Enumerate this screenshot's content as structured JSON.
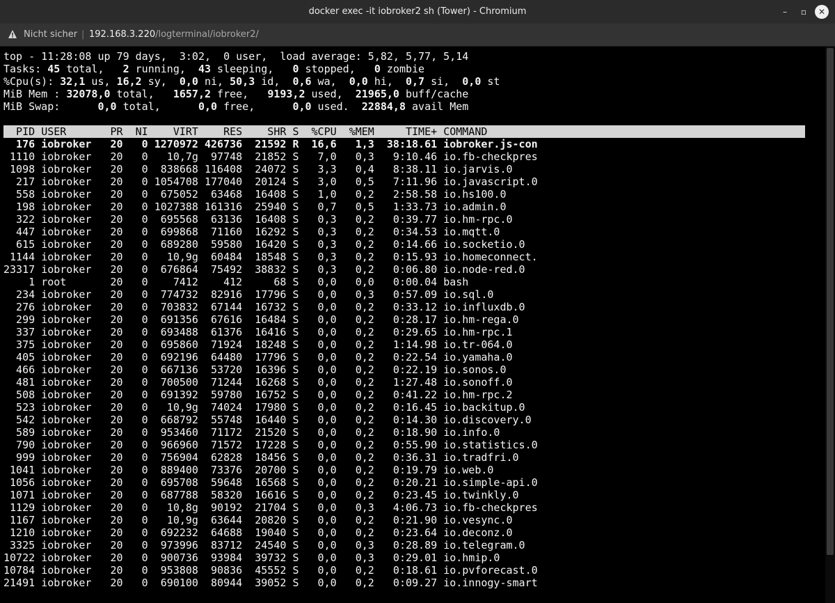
{
  "window": {
    "title": "docker exec -it iobroker2 sh (Tower) - Chromium",
    "buttons": [
      "–",
      "▫",
      "✕"
    ]
  },
  "address": {
    "security_label": "Nicht sicher",
    "separator": "|",
    "host": "192.168.3.220",
    "path": "/logterminal/iobroker2/"
  },
  "top": {
    "summary": [
      [
        [
          "top - 11:28:08 up 79 days,  3:02,  0 user,  load average: 5,82, 5,77, 5,14",
          false
        ]
      ],
      [
        [
          "Tasks: ",
          false
        ],
        [
          "45",
          true
        ],
        [
          " total,   ",
          false
        ],
        [
          "2",
          true
        ],
        [
          " running,  ",
          false
        ],
        [
          "43",
          true
        ],
        [
          " sleeping,   ",
          false
        ],
        [
          "0",
          true
        ],
        [
          " stopped,   ",
          false
        ],
        [
          "0",
          true
        ],
        [
          " zombie",
          false
        ]
      ],
      [
        [
          "%Cpu(s): ",
          false
        ],
        [
          "32,1",
          true
        ],
        [
          " us, ",
          false
        ],
        [
          "16,2",
          true
        ],
        [
          " sy,  ",
          false
        ],
        [
          "0,0",
          true
        ],
        [
          " ni, ",
          false
        ],
        [
          "50,3",
          true
        ],
        [
          " id,  ",
          false
        ],
        [
          "0,6",
          true
        ],
        [
          " wa,  ",
          false
        ],
        [
          "0,0",
          true
        ],
        [
          " hi,  ",
          false
        ],
        [
          "0,7",
          true
        ],
        [
          " si,  ",
          false
        ],
        [
          "0,0",
          true
        ],
        [
          " st",
          false
        ]
      ],
      [
        [
          "MiB Mem : ",
          false
        ],
        [
          "32078,0",
          true
        ],
        [
          " total,   ",
          false
        ],
        [
          "1657,2",
          true
        ],
        [
          " free,   ",
          false
        ],
        [
          "9193,2",
          true
        ],
        [
          " used,  ",
          false
        ],
        [
          "21965,0",
          true
        ],
        [
          " buff/cache",
          false
        ]
      ],
      [
        [
          "MiB Swap:      ",
          false
        ],
        [
          "0,0",
          true
        ],
        [
          " total,      ",
          false
        ],
        [
          "0,0",
          true
        ],
        [
          " free,      ",
          false
        ],
        [
          "0,0",
          true
        ],
        [
          " used.  ",
          false
        ],
        [
          "22884,8",
          true
        ],
        [
          " avail Mem",
          false
        ]
      ]
    ],
    "columns": [
      "PID",
      "USER",
      "PR",
      "NI",
      "VIRT",
      "RES",
      "SHR",
      "S",
      "%CPU",
      "%MEM",
      "TIME+",
      "COMMAND"
    ],
    "processes": [
      [
        "176",
        "iobroker",
        "20",
        "0",
        "1270972",
        "426736",
        "21592",
        "R",
        "16,6",
        "1,3",
        "38:18.61",
        "iobroker.js-con"
      ],
      [
        "1110",
        "iobroker",
        "20",
        "0",
        "10,7g",
        "97748",
        "21852",
        "S",
        "7,0",
        "0,3",
        "9:10.46",
        "io.fb-checkpres"
      ],
      [
        "1098",
        "iobroker",
        "20",
        "0",
        "838668",
        "116408",
        "24072",
        "S",
        "3,3",
        "0,4",
        "8:38.11",
        "io.jarvis.0"
      ],
      [
        "217",
        "iobroker",
        "20",
        "0",
        "1054708",
        "177040",
        "20124",
        "S",
        "3,0",
        "0,5",
        "7:11.96",
        "io.javascript.0"
      ],
      [
        "558",
        "iobroker",
        "20",
        "0",
        "675052",
        "63468",
        "16408",
        "S",
        "1,0",
        "0,2",
        "2:58.58",
        "io.hs100.0"
      ],
      [
        "198",
        "iobroker",
        "20",
        "0",
        "1027388",
        "161316",
        "25940",
        "S",
        "0,7",
        "0,5",
        "1:33.73",
        "io.admin.0"
      ],
      [
        "322",
        "iobroker",
        "20",
        "0",
        "695568",
        "63136",
        "16408",
        "S",
        "0,3",
        "0,2",
        "0:39.77",
        "io.hm-rpc.0"
      ],
      [
        "447",
        "iobroker",
        "20",
        "0",
        "699868",
        "71160",
        "16292",
        "S",
        "0,3",
        "0,2",
        "0:34.53",
        "io.mqtt.0"
      ],
      [
        "615",
        "iobroker",
        "20",
        "0",
        "689280",
        "59580",
        "16420",
        "S",
        "0,3",
        "0,2",
        "0:14.66",
        "io.socketio.0"
      ],
      [
        "1144",
        "iobroker",
        "20",
        "0",
        "10,9g",
        "60484",
        "18548",
        "S",
        "0,3",
        "0,2",
        "0:15.93",
        "io.homeconnect."
      ],
      [
        "23317",
        "iobroker",
        "20",
        "0",
        "676864",
        "75492",
        "38832",
        "S",
        "0,3",
        "0,2",
        "0:06.80",
        "io.node-red.0"
      ],
      [
        "1",
        "root",
        "20",
        "0",
        "7412",
        "412",
        "68",
        "S",
        "0,0",
        "0,0",
        "0:00.04",
        "bash"
      ],
      [
        "234",
        "iobroker",
        "20",
        "0",
        "774732",
        "82916",
        "17796",
        "S",
        "0,0",
        "0,3",
        "0:57.09",
        "io.sql.0"
      ],
      [
        "276",
        "iobroker",
        "20",
        "0",
        "703832",
        "67144",
        "16732",
        "S",
        "0,0",
        "0,2",
        "0:33.12",
        "io.influxdb.0"
      ],
      [
        "299",
        "iobroker",
        "20",
        "0",
        "691356",
        "67616",
        "16484",
        "S",
        "0,0",
        "0,2",
        "0:28.17",
        "io.hm-rega.0"
      ],
      [
        "337",
        "iobroker",
        "20",
        "0",
        "693488",
        "61376",
        "16416",
        "S",
        "0,0",
        "0,2",
        "0:29.65",
        "io.hm-rpc.1"
      ],
      [
        "375",
        "iobroker",
        "20",
        "0",
        "695860",
        "71924",
        "18248",
        "S",
        "0,0",
        "0,2",
        "1:14.98",
        "io.tr-064.0"
      ],
      [
        "405",
        "iobroker",
        "20",
        "0",
        "692196",
        "64480",
        "17796",
        "S",
        "0,0",
        "0,2",
        "0:22.54",
        "io.yamaha.0"
      ],
      [
        "466",
        "iobroker",
        "20",
        "0",
        "667136",
        "53720",
        "16396",
        "S",
        "0,0",
        "0,2",
        "0:22.19",
        "io.sonos.0"
      ],
      [
        "481",
        "iobroker",
        "20",
        "0",
        "700500",
        "71244",
        "16268",
        "S",
        "0,0",
        "0,2",
        "1:27.48",
        "io.sonoff.0"
      ],
      [
        "508",
        "iobroker",
        "20",
        "0",
        "691392",
        "59780",
        "16752",
        "S",
        "0,0",
        "0,2",
        "0:41.22",
        "io.hm-rpc.2"
      ],
      [
        "523",
        "iobroker",
        "20",
        "0",
        "10,9g",
        "74024",
        "17980",
        "S",
        "0,0",
        "0,2",
        "0:16.45",
        "io.backitup.0"
      ],
      [
        "542",
        "iobroker",
        "20",
        "0",
        "668792",
        "55748",
        "16440",
        "S",
        "0,0",
        "0,2",
        "0:14.30",
        "io.discovery.0"
      ],
      [
        "589",
        "iobroker",
        "20",
        "0",
        "953460",
        "71172",
        "21520",
        "S",
        "0,0",
        "0,2",
        "0:18.90",
        "io.info.0"
      ],
      [
        "790",
        "iobroker",
        "20",
        "0",
        "966960",
        "71572",
        "17228",
        "S",
        "0,0",
        "0,2",
        "0:55.90",
        "io.statistics.0"
      ],
      [
        "999",
        "iobroker",
        "20",
        "0",
        "756904",
        "62828",
        "18456",
        "S",
        "0,0",
        "0,2",
        "0:36.31",
        "io.tradfri.0"
      ],
      [
        "1041",
        "iobroker",
        "20",
        "0",
        "889400",
        "73376",
        "20700",
        "S",
        "0,0",
        "0,2",
        "0:19.79",
        "io.web.0"
      ],
      [
        "1056",
        "iobroker",
        "20",
        "0",
        "695708",
        "59648",
        "16568",
        "S",
        "0,0",
        "0,2",
        "0:20.21",
        "io.simple-api.0"
      ],
      [
        "1071",
        "iobroker",
        "20",
        "0",
        "687788",
        "58320",
        "16616",
        "S",
        "0,0",
        "0,2",
        "0:23.45",
        "io.twinkly.0"
      ],
      [
        "1129",
        "iobroker",
        "20",
        "0",
        "10,8g",
        "90192",
        "21704",
        "S",
        "0,0",
        "0,3",
        "4:06.73",
        "io.fb-checkpres"
      ],
      [
        "1167",
        "iobroker",
        "20",
        "0",
        "10,9g",
        "63644",
        "20820",
        "S",
        "0,0",
        "0,2",
        "0:21.90",
        "io.vesync.0"
      ],
      [
        "1210",
        "iobroker",
        "20",
        "0",
        "692232",
        "64688",
        "19040",
        "S",
        "0,0",
        "0,2",
        "0:23.64",
        "io.deconz.0"
      ],
      [
        "3325",
        "iobroker",
        "20",
        "0",
        "973996",
        "83712",
        "24540",
        "S",
        "0,0",
        "0,3",
        "0:28.89",
        "io.telegram.0"
      ],
      [
        "10722",
        "iobroker",
        "20",
        "0",
        "900736",
        "93984",
        "39732",
        "S",
        "0,0",
        "0,3",
        "0:29.01",
        "io.hmip.0"
      ],
      [
        "10784",
        "iobroker",
        "20",
        "0",
        "953808",
        "90836",
        "45552",
        "S",
        "0,0",
        "0,2",
        "0:18.61",
        "io.pvforecast.0"
      ],
      [
        "21491",
        "iobroker",
        "20",
        "0",
        "690100",
        "80944",
        "39052",
        "S",
        "0,0",
        "0,2",
        "0:09.27",
        "io.innogy-smart"
      ]
    ]
  }
}
